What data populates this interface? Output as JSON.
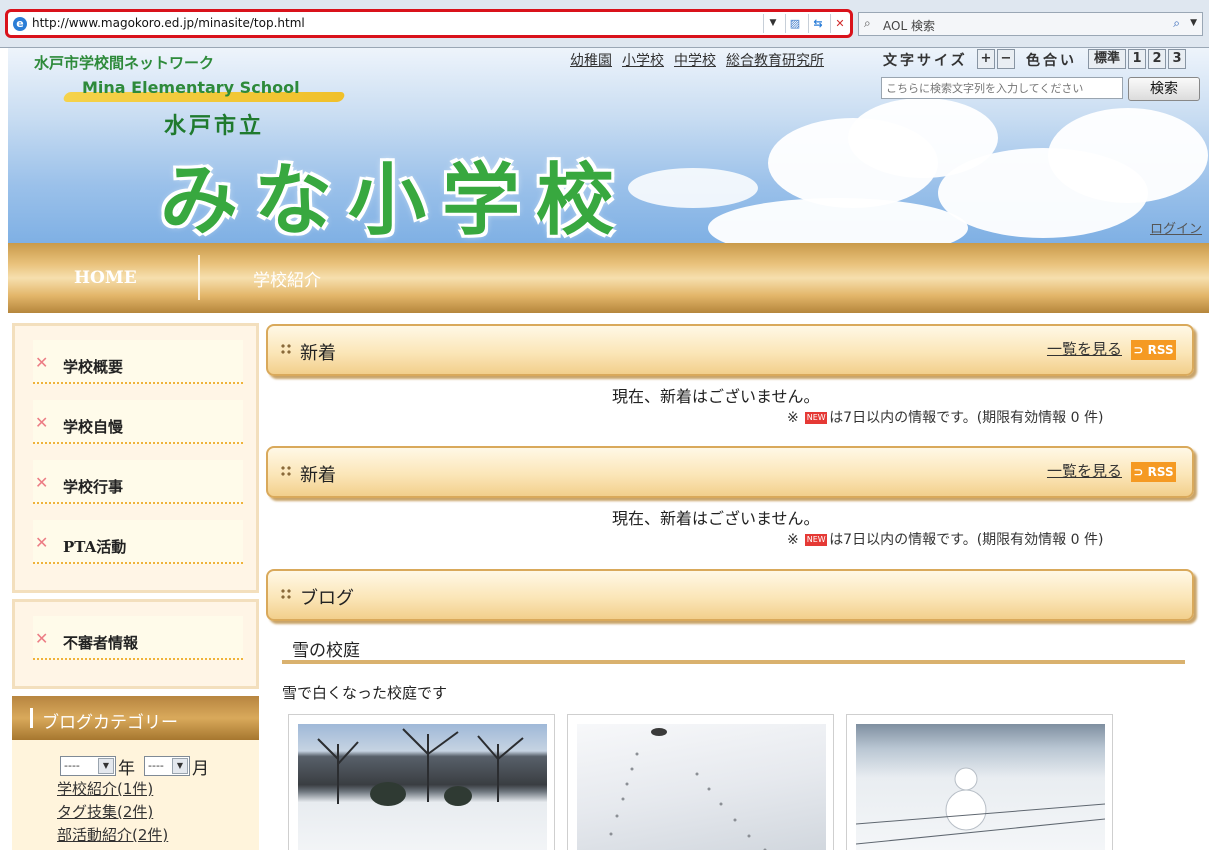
{
  "browser": {
    "url": "http://www.magokoro.ed.jp/minasite/top.html",
    "search_placeholder": "AOL 検索"
  },
  "header": {
    "network_title": "水戸市学校間ネットワーク",
    "english_name": "Mina Elementary School",
    "city_label": "水戸市立",
    "school_name": "みな小学校",
    "top_links": [
      "幼稚園",
      "小学校",
      "中学校",
      "総合教育研究所"
    ],
    "font_size_label": "文字サイズ",
    "font_plus": "+",
    "font_minus": "−",
    "color_label": "色合い",
    "color_buttons": [
      "標準",
      "1",
      "2",
      "3"
    ],
    "search_placeholder": "こちらに検索文字列を入力してください",
    "search_button": "検索",
    "login": "ログイン"
  },
  "nav": {
    "home": "HOME",
    "about": "学校紹介"
  },
  "sidebar": {
    "menu_items": [
      "学校概要",
      "学校自慢",
      "学校行事",
      "PTA活動"
    ],
    "alert_item": "不審者情報",
    "blog_category": {
      "title": "ブログカテゴリー",
      "year_value": "----",
      "year_label": "年",
      "month_value": "----",
      "month_label": "月",
      "links": [
        "学校紹介(1件)",
        "タグ技集(2件)",
        "部活動紹介(2件)"
      ]
    }
  },
  "main": {
    "news_blocks": [
      {
        "title": "新着",
        "list_link": "一覧を見る",
        "rss": "RSS",
        "empty_text": "現在、新着はございません。",
        "note_prefix": "※",
        "new_badge": "NEW",
        "note_suffix": "は7日以内の情報です。(期限有効情報 0 件)"
      },
      {
        "title": "新着",
        "list_link": "一覧を見る",
        "rss": "RSS",
        "empty_text": "現在、新着はございません。",
        "note_prefix": "※",
        "new_badge": "NEW",
        "note_suffix": "は7日以内の情報です。(期限有効情報 0 件)"
      }
    ],
    "blog": {
      "title": "ブログ",
      "post_title": "雪の校庭",
      "post_body": "雪で白くなった校庭です"
    }
  }
}
